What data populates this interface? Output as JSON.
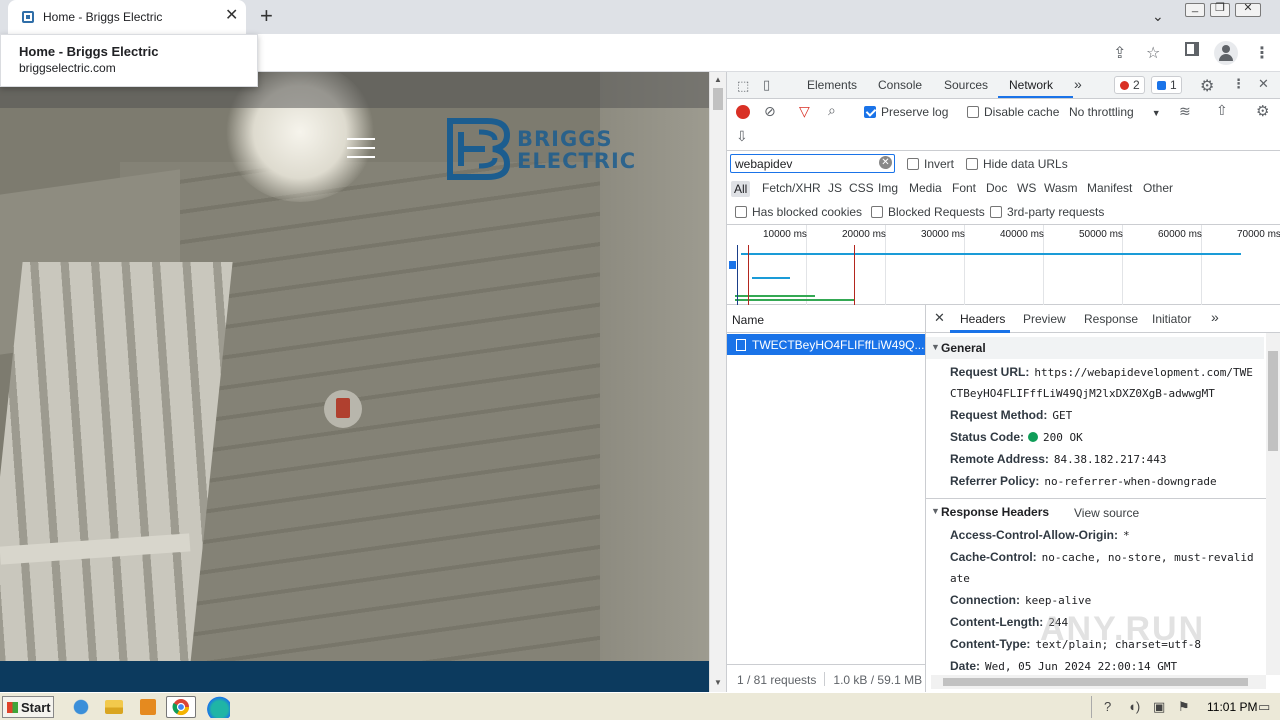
{
  "browser": {
    "tab_title": "Home - Briggs Electric",
    "new_tab": "+",
    "tab_close": "✕",
    "tab_search": "⌄",
    "hover_card": {
      "title": "Home - Briggs Electric",
      "url": "briggselectric.com"
    }
  },
  "site": {
    "logo_line1": "BRIGGS",
    "logo_line2": "ELECTRIC"
  },
  "devtools": {
    "tabs": [
      "Elements",
      "Console",
      "Sources",
      "Network"
    ],
    "more": "»",
    "active_tab": "Network",
    "errors": "2",
    "messages": "1",
    "toolbar": {
      "preserve_log": "Preserve log",
      "disable_cache": "Disable cache",
      "throttling": "No throttling"
    },
    "filter": {
      "value": "webapidev",
      "invert": "Invert",
      "hide_data_urls": "Hide data URLs",
      "types": [
        "All",
        "Fetch/XHR",
        "JS",
        "CSS",
        "Img",
        "Media",
        "Font",
        "Doc",
        "WS",
        "Wasm",
        "Manifest",
        "Other"
      ],
      "has_blocked_cookies": "Has blocked cookies",
      "blocked_requests": "Blocked Requests",
      "third_party": "3rd-party requests"
    },
    "overview_ticks": [
      "10000 ms",
      "20000 ms",
      "30000 ms",
      "40000 ms",
      "50000 ms",
      "60000 ms",
      "70000 ms"
    ],
    "requests": {
      "column": "Name",
      "selected": "TWECTBeyHO4FLIFffLiW49Q...",
      "count": "1 / 81 requests",
      "size": "1.0 kB / 59.1 MB"
    },
    "details": {
      "tabs": [
        "Headers",
        "Preview",
        "Response",
        "Initiator"
      ],
      "general_title": "General",
      "request_url_label": "Request URL:",
      "request_url_1": "https://webapidevelopment.com/TWE",
      "request_url_2": "CTBeyHO4FLIFffLiW49QjM2lxDXZ0XgB-adwwgMT",
      "request_method_label": "Request Method:",
      "request_method": "GET",
      "status_code_label": "Status Code:",
      "status_code": "200 OK",
      "remote_address_label": "Remote Address:",
      "remote_address": "84.38.182.217:443",
      "referrer_policy_label": "Referrer Policy:",
      "referrer_policy": "no-referrer-when-downgrade",
      "response_headers_title": "Response Headers",
      "view_source": "View source",
      "acao_label": "Access-Control-Allow-Origin:",
      "acao": "*",
      "cache_control_label": "Cache-Control:",
      "cache_control_1": "no-cache, no-store, must-revalid",
      "cache_control_2": "ate",
      "connection_label": "Connection:",
      "connection": "keep-alive",
      "content_length_label": "Content-Length:",
      "content_length": "244",
      "content_type_label": "Content-Type:",
      "content_type": "text/plain; charset=utf-8",
      "date_label": "Date:",
      "date": "Wed, 05 Jun 2024 22:00:14 GMT"
    },
    "watermark": "ANY.RUN"
  },
  "taskbar": {
    "start": "Start",
    "clock": "11:01 PM"
  },
  "colors": {
    "accent": "#1a73e8",
    "record": "#d93025",
    "brand": "#1c5d8f",
    "footer": "#0c3a5e"
  }
}
